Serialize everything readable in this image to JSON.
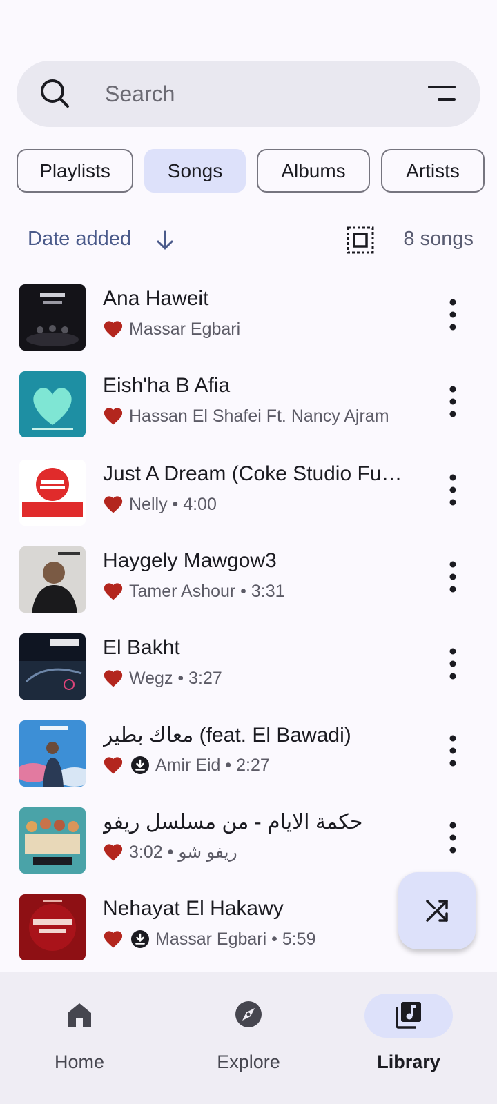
{
  "search": {
    "placeholder": "Search"
  },
  "chips": [
    {
      "label": "Playlists",
      "selected": false
    },
    {
      "label": "Songs",
      "selected": true
    },
    {
      "label": "Albums",
      "selected": false
    },
    {
      "label": "Artists",
      "selected": false
    }
  ],
  "sort": {
    "label": "Date added",
    "direction": "descending",
    "count_label": "8 songs"
  },
  "songs": [
    {
      "title": "Ana Haweit",
      "subtitle": "Massar Egbari",
      "liked": true,
      "downloaded": false
    },
    {
      "title": "Eish'ha B Afia",
      "subtitle": "Hassan El Shafei Ft. Nancy Ajram",
      "liked": true,
      "downloaded": false
    },
    {
      "title": "Just A Dream (Coke Studio Fusion)",
      "subtitle": "Nelly • 4:00",
      "liked": true,
      "downloaded": false
    },
    {
      "title": "Haygely Mawgow3",
      "subtitle": "Tamer Ashour • 3:31",
      "liked": true,
      "downloaded": false
    },
    {
      "title": "El Bakht",
      "subtitle": "Wegz • 3:27",
      "liked": true,
      "downloaded": false
    },
    {
      "title": "معاك بطير (feat. El Bawadi)",
      "subtitle": "Amir Eid • 2:27",
      "liked": true,
      "downloaded": true
    },
    {
      "title": "حكمة الايام - من مسلسل ريفو",
      "subtitle": "ريفو شو • 3:02",
      "liked": true,
      "downloaded": false
    },
    {
      "title": "Nehayat El Hakawy",
      "subtitle": "Massar Egbari • 5:59",
      "liked": true,
      "downloaded": true
    }
  ],
  "bottom_nav": [
    {
      "label": "Home",
      "icon": "home-icon",
      "active": false
    },
    {
      "label": "Explore",
      "icon": "explore-icon",
      "active": false
    },
    {
      "label": "Library",
      "icon": "library-icon",
      "active": true
    }
  ],
  "colors": {
    "accent": "#dde1fa",
    "heart": "#b3261e",
    "background": "#fbf9fe"
  }
}
